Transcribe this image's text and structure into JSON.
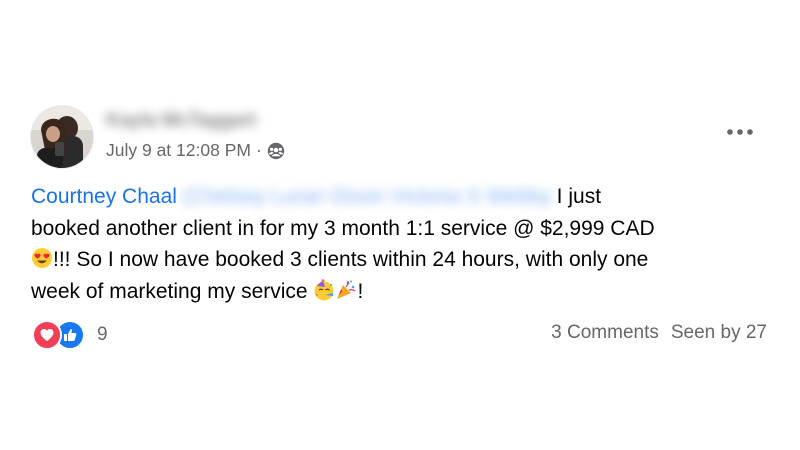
{
  "post": {
    "author": "Kayla McTaggart",
    "timestamp": "July 9 at 12:08 PM",
    "separator": "·",
    "audience_icon": "group-audience-icon",
    "more_icon": "more-options-icon",
    "mention_name": "Courtney Chaal",
    "mention_open": "(",
    "tagged_names": "Chelsey Luran Dixon Victoria S Webby",
    "line1_end": " I just",
    "line2": "booked another client in for my 3 month 1:1 service @ $2,999 CAD",
    "line3": "!!! So I now have booked 3 clients within 24 hours, with only one",
    "line4_a": "week of marketing my service ",
    "line4_b": "!",
    "emojis": [
      "heart-eyes-emoji",
      "party-face-emoji",
      "party-popper-emoji"
    ]
  },
  "footer": {
    "reaction_icons": [
      "love-reaction-icon",
      "like-reaction-icon"
    ],
    "reaction_count": "9",
    "comments": "3 Comments",
    "seen_by": "Seen by 27"
  },
  "colors": {
    "mention": "#1a73e8",
    "secondary_text": "#65676b",
    "love": "#f33e58",
    "like": "#1877f2"
  }
}
